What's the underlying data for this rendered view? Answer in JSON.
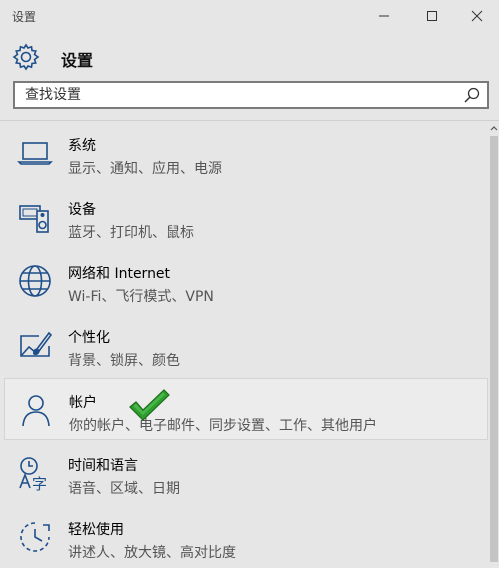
{
  "window": {
    "title": "设置"
  },
  "header": {
    "title": "设置"
  },
  "search": {
    "placeholder": "查找设置"
  },
  "items": [
    {
      "name": "系统",
      "desc": "显示、通知、应用、电源",
      "icon": "laptop-icon"
    },
    {
      "name": "设备",
      "desc": "蓝牙、打印机、鼠标",
      "icon": "devices-icon"
    },
    {
      "name": "网络和 Internet",
      "desc": "Wi-Fi、飞行模式、VPN",
      "icon": "globe-icon"
    },
    {
      "name": "个性化",
      "desc": "背景、锁屏、颜色",
      "icon": "personalization-icon"
    },
    {
      "name": "帐户",
      "desc": "你的帐户、电子邮件、同步设置、工作、其他用户",
      "icon": "person-icon",
      "selected": true
    },
    {
      "name": "时间和语言",
      "desc": "语音、区域、日期",
      "icon": "time-language-icon"
    },
    {
      "name": "轻松使用",
      "desc": "讲述人、放大镜、高对比度",
      "icon": "ease-of-access-icon"
    }
  ],
  "colors": {
    "background": "#e6e6e6",
    "accent_check": "#2e9e2e",
    "icon": "#1f4f8a"
  }
}
